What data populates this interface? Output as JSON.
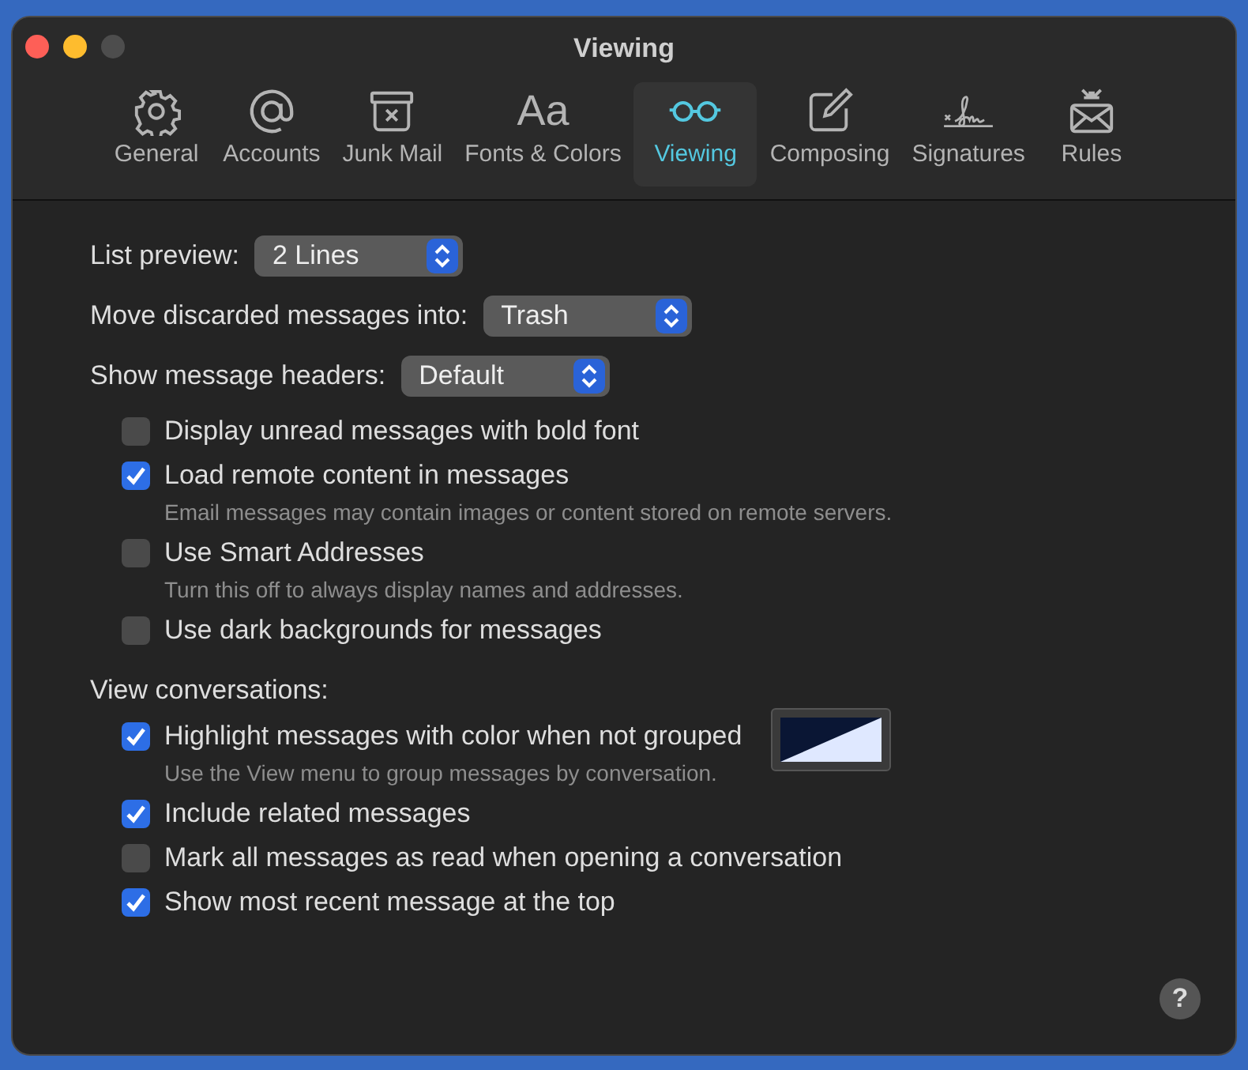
{
  "window": {
    "title": "Viewing"
  },
  "tabs": [
    {
      "label": "General",
      "selected": false
    },
    {
      "label": "Accounts",
      "selected": false
    },
    {
      "label": "Junk Mail",
      "selected": false
    },
    {
      "label": "Fonts & Colors",
      "glyph": "Aa",
      "selected": false
    },
    {
      "label": "Viewing",
      "selected": true
    },
    {
      "label": "Composing",
      "selected": false
    },
    {
      "label": "Signatures",
      "selected": false
    },
    {
      "label": "Rules",
      "selected": false
    }
  ],
  "settings": [
    {
      "kind": "popup",
      "label": "List preview:",
      "value": "2 Lines"
    },
    {
      "kind": "popup",
      "label": "Move discarded messages into:",
      "value": "Trash"
    },
    {
      "kind": "popup",
      "label": "Show message headers:",
      "value": "Default"
    },
    {
      "kind": "checkbox",
      "label": "Display unread messages with bold font",
      "checked": false
    },
    {
      "kind": "checkbox",
      "label": "Load remote content in messages",
      "checked": true,
      "hint": "Email messages may contain images or content stored on remote servers."
    },
    {
      "kind": "checkbox",
      "label": "Use Smart Addresses",
      "checked": false,
      "hint": "Turn this off to always display names and addresses."
    },
    {
      "kind": "checkbox",
      "label": "Use dark backgrounds for messages",
      "checked": false
    },
    {
      "kind": "heading",
      "label": "View conversations:"
    },
    {
      "kind": "checkbox-color",
      "label": "Highlight messages with color when not grouped",
      "checked": true,
      "hint": "Use the View menu to group messages by conversation."
    },
    {
      "kind": "checkbox",
      "label": "Include related messages",
      "checked": true
    },
    {
      "kind": "checkbox",
      "label": "Mark all messages as read when opening a conversation",
      "checked": false
    },
    {
      "kind": "checkbox",
      "label": "Show most recent message at the top",
      "checked": true
    }
  ],
  "help": "?"
}
